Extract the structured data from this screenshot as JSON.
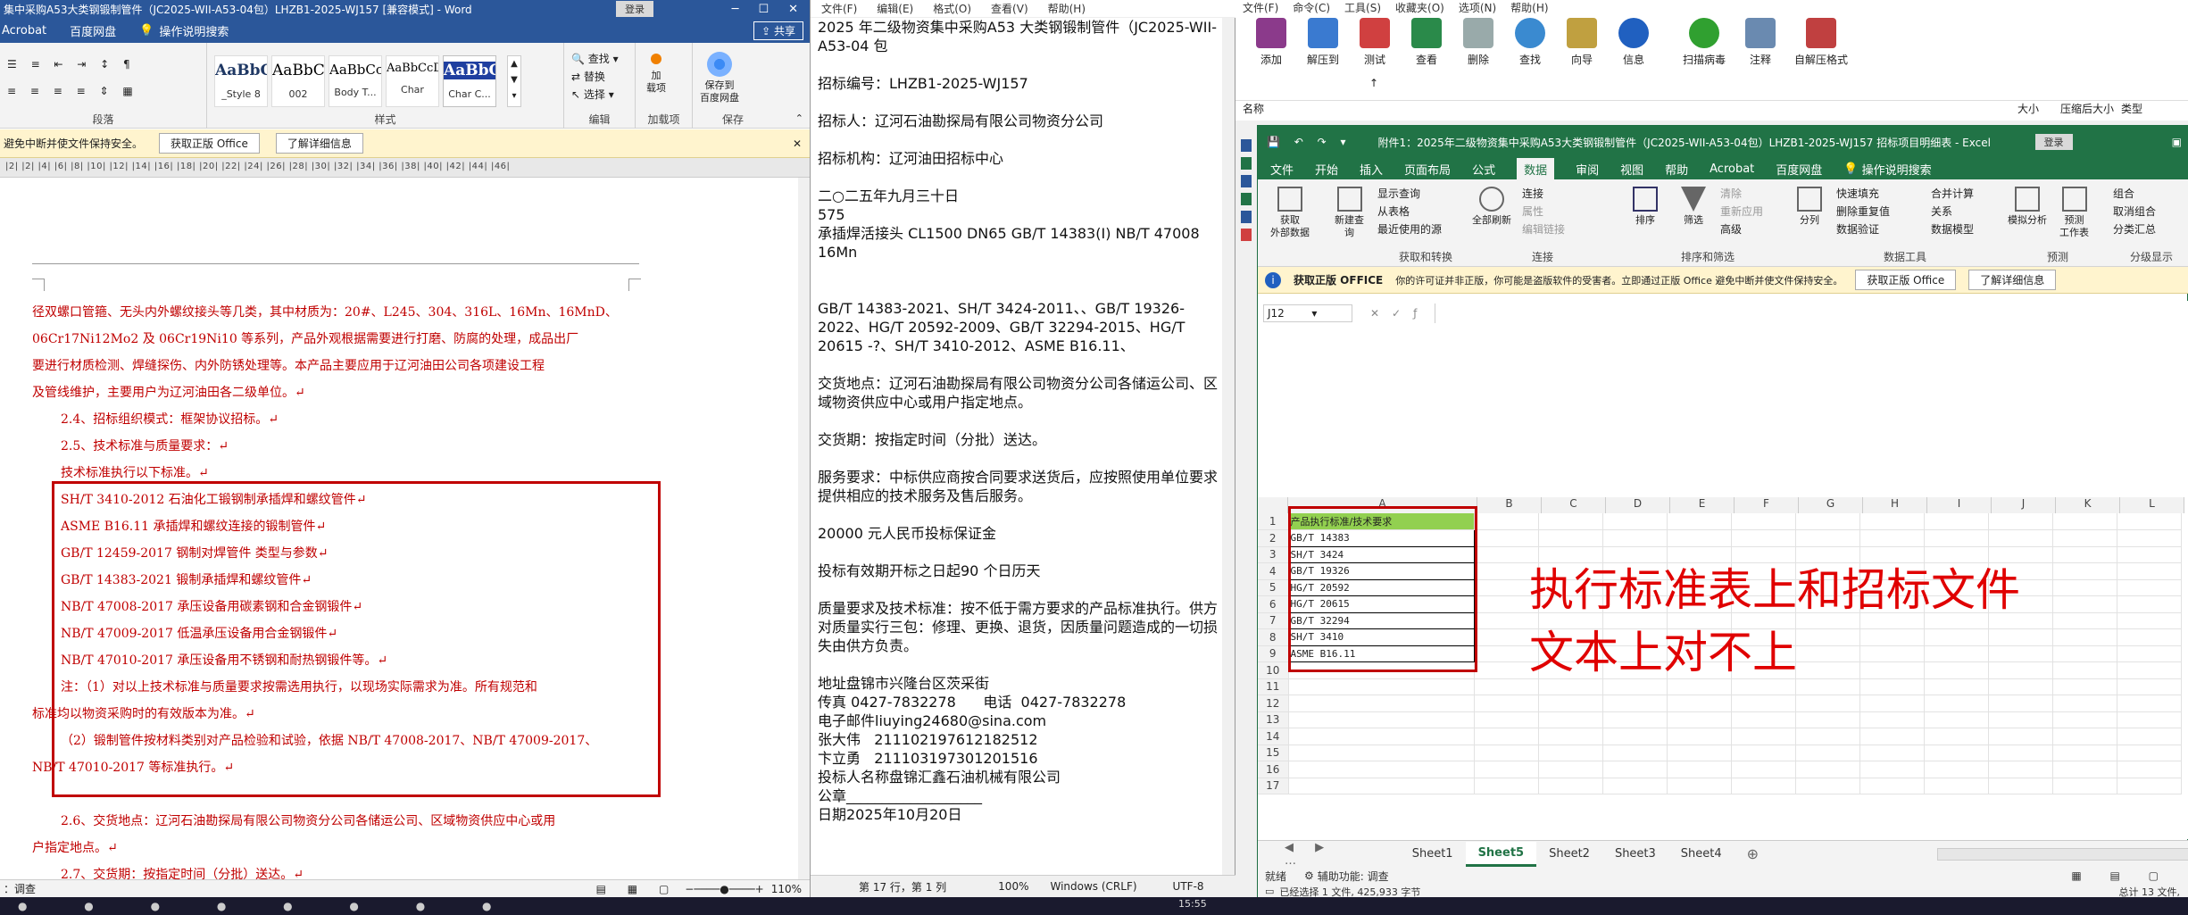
{
  "word": {
    "title": "集中采购A53大类钢锻制管件（JC2025-WII-A53-04包）LHZB1-2025-WJ157 [兼容模式] - Word",
    "login": "登录",
    "tabs": [
      "Acrobat",
      "百度网盘"
    ],
    "tellme": "操作说明搜索",
    "share": "共享",
    "styles": [
      {
        "preview": "AaBbC",
        "name": "_Style 8"
      },
      {
        "preview": "AaBbCc",
        "name": "002"
      },
      {
        "preview": "AaBbCcl",
        "name": "Body T..."
      },
      {
        "preview": "AaBbCcDc",
        "name": "Char"
      },
      {
        "preview": "AaBbCc",
        "name": "Char C..."
      }
    ],
    "groups": {
      "paragraph": "段落",
      "styles": "样式",
      "editing": "编辑",
      "addins": "加载项",
      "save": "保存"
    },
    "editing_cmds": [
      "查找",
      "替换",
      "选择"
    ],
    "addin_label": "加\n载项",
    "save_label": "保存到\n百度网盘",
    "warn_text": "避免中断并使文件保持安全。",
    "warn_btn1": "获取正版 Office",
    "warn_btn2": "了解详细信息",
    "ruler": "|2|  |2|  |4|  |6|  |8|  |10|  |12|  |14|  |16|  |18|  |20|  |22|  |24|  |26|  |28|  |30|  |32|  |34|  |36|  |38|  |40|  |42|  |44|  |46|",
    "lines": [
      "径双螺口管箍、无头内外螺纹接头等几类，其中材质为：20#、L245、304、316L、16Mn、16MnD、",
      "06Cr17Ni12Mo2 及 06Cr19Ni10 等系列，产品外观根据需要进行打磨、防腐的处理，成品出厂",
      "要进行材质检测、焊缝探伤、内外防锈处理等。本产品主要应用于辽河油田公司各项建设工程",
      "及管线维护，主要用户为辽河油田各二级单位。↵",
      "2.4、招标组织模式：框架协议招标。↵",
      "2.5、技术标准与质量要求：↵",
      "技术标准执行以下标准。↵",
      "SH/T 3410-2012  石油化工锻钢制承插焊和螺纹管件↵",
      "ASME B16.11 承插焊和螺纹连接的锻制管件↵",
      "GB/T 12459-2017  钢制对焊管件  类型与参数↵",
      "GB/T 14383-2021 锻制承插焊和螺纹管件↵",
      "NB/T 47008-2017 承压设备用碳素钢和合金钢锻件↵",
      "NB/T 47009-2017  低温承压设备用合金钢锻件↵",
      "NB/T 47010-2017  承压设备用不锈钢和耐热钢锻件等。↵",
      "注：（1）对以上技术标准与质量要求按需选用执行，以现场实际需求为准。所有规范和",
      "标准均以物资采购时的有效版本为准。↵",
      "（2）锻制管件按材料类别对产品检验和试验，依据 NB/T 47008-2017、NB/T 47009-2017、",
      "NB/T 47010-2017 等标准执行。↵",
      "2.6、交货地点：辽河石油勘探局有限公司物资分公司各储运公司、区域物资供应中心或用",
      "户指定地点。↵",
      "2.7、交货期：按指定时间（分批）送达。↵"
    ],
    "status_left": "：调查",
    "zoom": "110%"
  },
  "notepad": {
    "menu": [
      "文件(F)",
      "编辑(E)",
      "格式(O)",
      "查看(V)",
      "帮助(H)"
    ],
    "text": "2025 年二级物资集中采购A53 大类钢锻制管件（JC2025-WII-A53-04 包\n\n招标编号：LHZB1-2025-WJ157\n\n招标人：辽河石油勘探局有限公司物资分公司\n\n招标机构：辽河油田招标中心\n\n二○二五年九月三十日\n575\n承插焊活接头 CL1500 DN65 GB/T 14383(Ⅰ) NB/T 47008 16Mn\n\n\nGB/T 14383-2021、SH/T 3424-2011、、GB/T 19326-2022、HG/T 20592-2009、GB/T 32294-2015、HG/T 20615 -?、SH/T 3410-2012、ASME B16.11、\n\n交货地点：辽河石油勘探局有限公司物资分公司各储运公司、区域物资供应中心或用户指定地点。\n\n交货期：按指定时间（分批）送达。\n\n服务要求：中标供应商按合同要求送货后，应按照使用单位要求提供相应的技术服务及售后服务。\n\n20000 元人民币投标保证金\n\n投标有效期开标之日起90 个日历天\n\n质量要求及技术标准：按不低于需方要求的产品标准执行。供方对质量实行三包：修理、更换、退货，因质量问题造成的一切损失由供方负责。\n\n地址盘锦市兴隆台区茨采街\n传真 0427-7832278      电话  0427-7832278\n电子邮件liuying24680@sina.com\n张大伟   211102197612182512\n卞立勇   211103197301201516\n投标人名称盘锦汇鑫石油机械有限公司\n公章___________________\n日期2025年10月20日",
    "status": [
      "第 17 行，第 1 列",
      "100%",
      "Windows (CRLF)",
      "UTF-8"
    ]
  },
  "archive": {
    "menu": [
      "文件(F)",
      "命令(C)",
      "工具(S)",
      "收藏夹(O)",
      "选项(N)",
      "帮助(H)"
    ],
    "buttons": [
      "添加",
      "解压到",
      "测试",
      "查看",
      "删除",
      "查找",
      "向导",
      "信息",
      "扫描病毒",
      "注释",
      "自解压格式"
    ],
    "header": [
      "名称",
      "大小",
      "压缩后大小",
      "类型"
    ]
  },
  "excel": {
    "title": "附件1：2025年二级物资集中采购A53大类钢锻制管件（JC2025-WII-A53-04包）LHZB1-2025-WJ157  招标项目明细表 - Excel",
    "login": "登录",
    "tabs": [
      "文件",
      "开始",
      "插入",
      "页面布局",
      "公式",
      "数据",
      "审阅",
      "视图",
      "帮助",
      "Acrobat",
      "百度网盘"
    ],
    "active_tab": "数据",
    "tellme": "操作说明搜索",
    "ribbon_groups": [
      "获取和转换",
      "连接",
      "排序和筛选",
      "数据工具",
      "预测",
      "分级显示"
    ],
    "ribbon_cmds": [
      "获取\n外部数据",
      "新建查\n询",
      "显示查询",
      "从表格",
      "最近使用的源",
      "全部刷新",
      "连接",
      "属性",
      "编辑链接",
      "排序",
      "筛选",
      "清除",
      "重新应用",
      "高级",
      "分列",
      "快速填充",
      "删除重复值",
      "数据验证",
      "合并计算",
      "关系",
      "数据模型",
      "模拟分析",
      "预测\n工作表",
      "组合",
      "取消组合",
      "分类汇总"
    ],
    "warn_title": "获取正版 OFFICE",
    "warn_text": "你的许可证并非正版，你可能是盗版软件的受害者。立即通过正版 Office 避免中断并使文件保持安全。",
    "warn_btn1": "获取正版 Office",
    "warn_btn2": "了解详细信息",
    "namebox": "J12",
    "columns": [
      "A",
      "B",
      "C",
      "D",
      "E",
      "F",
      "G",
      "H",
      "I",
      "J",
      "K",
      "L"
    ],
    "header_cell": "产品执行标准/技术要求",
    "rows": [
      "GB/T 14383",
      "SH/T 3424",
      "GB/T 19326",
      "HG/T 20592",
      "HG/T 20615",
      "GB/T 32294",
      "SH/T 3410",
      "ASME B16.11"
    ],
    "row_numbers": [
      "1",
      "2",
      "3",
      "4",
      "5",
      "6",
      "7",
      "8",
      "9",
      "10",
      "11",
      "12",
      "13",
      "14",
      "15",
      "16",
      "17"
    ],
    "sheets": [
      "Sheet1",
      "Sheet5",
      "Sheet2",
      "Sheet3",
      "Sheet4"
    ],
    "active_sheet": "Sheet5",
    "status_left": "就绪",
    "status_access": "辅助功能: 调查",
    "status2_left": "已经选择 1 文件, 425,933 字节",
    "status2_right": "总计 13 文件,"
  },
  "annotation": {
    "line1": "执行标准表上和招标文件",
    "line2": "文本上对不上"
  },
  "taskbar": {
    "time": "15:55"
  },
  "colors": {
    "word_blue": "#2b579a",
    "excel_green": "#217346",
    "annot_red": "#e00000",
    "doc_red": "#c00000"
  }
}
